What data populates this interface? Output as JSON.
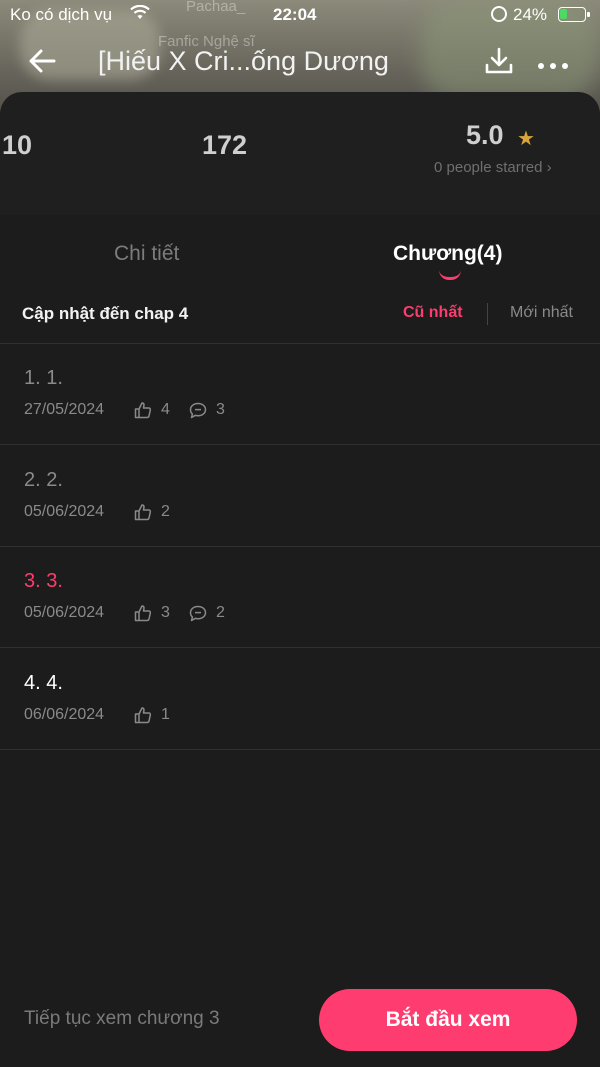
{
  "status_bar": {
    "carrier": "Ko có dịch vụ",
    "time": "22:04",
    "battery_pct": "24%",
    "battery_level": 0.24,
    "battery_color": "#4cd964"
  },
  "header": {
    "author_faint": "Pachaa_",
    "genre_faint": "Fanfic Nghệ sĩ",
    "title": "[Hiếu X Cri...ống Dương",
    "icons": [
      "back-arrow-icon",
      "download-icon",
      "more-icon"
    ]
  },
  "stats": {
    "stat_a": "10",
    "stat_b": "172",
    "rating": "5.0",
    "starred_text": "0 people starred",
    "star_color": "#d9a53a"
  },
  "tabs": [
    {
      "label": "Chi tiết",
      "active": false
    },
    {
      "label": "Chương(4)",
      "active": true
    }
  ],
  "filter": {
    "update_label": "Cập nhật đến chap 4",
    "sort_old": "Cũ nhất",
    "sort_new": "Mới nhất",
    "active_sort": "Cũ nhất"
  },
  "chapters": [
    {
      "title": "1. 1.",
      "date": "27/05/2024",
      "likes": "4",
      "comments": "3",
      "state": "read",
      "color": "#8a8a8a"
    },
    {
      "title": "2. 2.",
      "date": "05/06/2024",
      "likes": "2",
      "comments": null,
      "state": "read",
      "color": "#8a8a8a"
    },
    {
      "title": "3. 3.",
      "date": "05/06/2024",
      "likes": "3",
      "comments": "2",
      "state": "current",
      "color": "#ff3c6f"
    },
    {
      "title": "4. 4.",
      "date": "06/06/2024",
      "likes": "1",
      "comments": null,
      "state": "unread",
      "color": "#ffffff"
    }
  ],
  "bottom": {
    "continue_text": "Tiếp tục xem chương 3",
    "start_button": "Bắt đầu xem"
  },
  "colors": {
    "accent": "#ff3c6f",
    "background": "#1c1c1c"
  }
}
